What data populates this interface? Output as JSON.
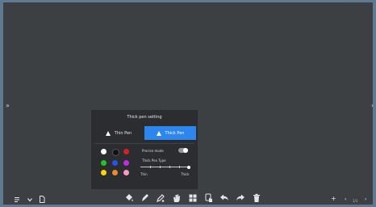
{
  "panel": {
    "title": "Thick pen setting",
    "tabs": {
      "thin": "Thin Pen",
      "thick": "Thick Pen"
    },
    "selected_tab": "Thick Pen",
    "colors": [
      "#ffffff",
      "#111111",
      "#d32222",
      "#22c322",
      "#2455e6",
      "#c32be0",
      "#ffd400",
      "#f08a24",
      "#ff9bc4"
    ],
    "pressure_label": "Precise mode",
    "pressure_enabled": true,
    "type_label": "Thick Pen Type",
    "slider": {
      "min_label": "Thin",
      "max_label": "Thick",
      "value_fraction": 1.0
    }
  },
  "side_arrows": {
    "left": "»",
    "right": "›"
  },
  "toolbar": {
    "icons": [
      "paint-bucket-icon",
      "pen-icon",
      "highlighter-icon",
      "eraser-hand-icon",
      "grid-icon",
      "touch-icon",
      "undo-icon",
      "redo-icon",
      "trash-icon"
    ]
  },
  "bottom_right": {
    "add": "+",
    "prev": "‹",
    "page": "1/1",
    "next": "›"
  }
}
